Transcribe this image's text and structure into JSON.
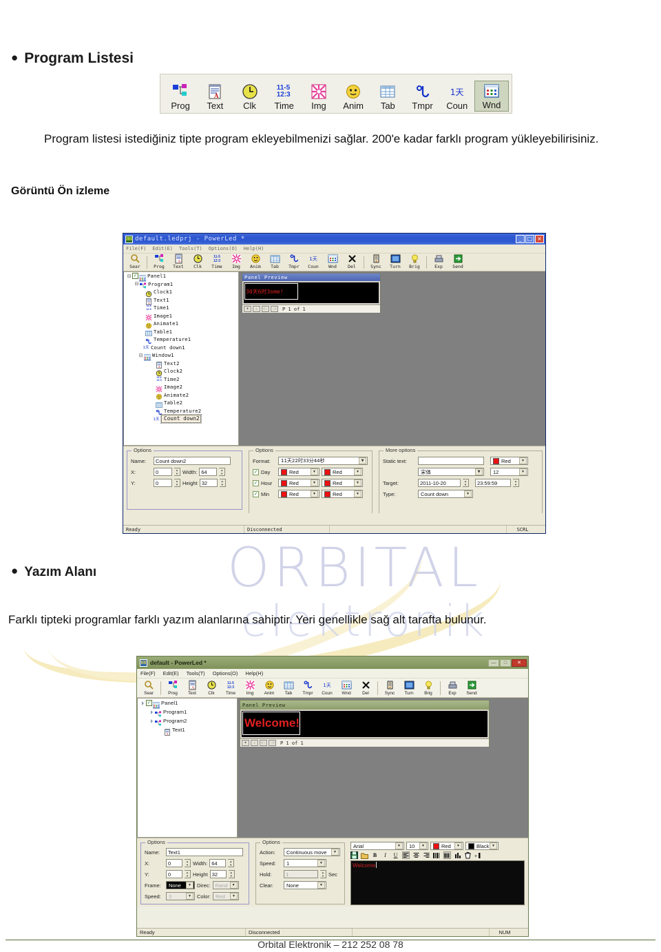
{
  "document": {
    "bullet1": "Program Listesi",
    "paragraph1": "Program listesi istediğiniz tipte program ekleyebilmenizi sağlar. 200'e kadar farklı program yükleyebilirisiniz.",
    "section1": "Görüntü Ön izleme",
    "bullet2": "Yazım Alanı",
    "paragraph2": "Farklı tipteki programlar farklı yazım alanlarına sahiptir. Yeri genellikle sağ alt tarafta bulunur.",
    "footer": "Orbital Elektronik – 212 252 08 78"
  },
  "watermark": {
    "line1": "ORBITAL",
    "line2": "elektronik"
  },
  "program_list_toolbar": {
    "items": [
      {
        "label": "Prog",
        "icon": "program-icon"
      },
      {
        "label": "Text",
        "icon": "text-icon"
      },
      {
        "label": "Clk",
        "icon": "clock-icon"
      },
      {
        "label": "Time",
        "icon": "time-icon"
      },
      {
        "label": "Img",
        "icon": "image-icon"
      },
      {
        "label": "Anim",
        "icon": "animate-icon"
      },
      {
        "label": "Tab",
        "icon": "table-icon"
      },
      {
        "label": "Tmpr",
        "icon": "temperature-icon"
      },
      {
        "label": "Coun",
        "icon": "countdown-icon"
      },
      {
        "label": "Wnd",
        "icon": "window-icon"
      }
    ],
    "selected": "Wnd"
  },
  "screenshot1": {
    "title": "default.ledprj - PowerLed *",
    "window_buttons": [
      "_",
      "□",
      "×"
    ],
    "menus": [
      "File(F)",
      "Edit(E)",
      "Tools(T)",
      "Options(O)",
      "Help(H)"
    ],
    "toolbar": [
      {
        "label": "Sear",
        "icon": "search-icon"
      },
      {
        "label": "Prog",
        "icon": "program-icon"
      },
      {
        "label": "Text",
        "icon": "text-icon"
      },
      {
        "label": "Clk",
        "icon": "clock-icon"
      },
      {
        "label": "Time",
        "icon": "time-icon"
      },
      {
        "label": "Img",
        "icon": "image-icon"
      },
      {
        "label": "Anim",
        "icon": "animate-icon"
      },
      {
        "label": "Tab",
        "icon": "table-icon"
      },
      {
        "label": "Tmpr",
        "icon": "temperature-icon"
      },
      {
        "label": "Coun",
        "icon": "countdown-icon"
      },
      {
        "label": "Wnd",
        "icon": "window-icon"
      },
      {
        "label": "Del",
        "icon": "delete-icon"
      },
      {
        "label": "Sync",
        "icon": "sync-icon"
      },
      {
        "label": "Turn",
        "icon": "turn-icon"
      },
      {
        "label": "Brig",
        "icon": "brightness-icon"
      },
      {
        "label": "Exp",
        "icon": "export-icon"
      },
      {
        "label": "Send",
        "icon": "send-icon"
      }
    ],
    "tree": [
      {
        "label": "Panel1",
        "depth": 0,
        "icon": "panel-icon",
        "checkbox": true,
        "expander": "minus"
      },
      {
        "label": "Program1",
        "depth": 1,
        "icon": "program-icon",
        "expander": "minus"
      },
      {
        "label": "Clock1",
        "depth": 2,
        "icon": "clock-icon"
      },
      {
        "label": "Text1",
        "depth": 2,
        "icon": "text-icon"
      },
      {
        "label": "Time1",
        "depth": 2,
        "icon": "time-icon"
      },
      {
        "label": "Image1",
        "depth": 2,
        "icon": "image-icon"
      },
      {
        "label": "Animate1",
        "depth": 2,
        "icon": "animate-icon"
      },
      {
        "label": "Table1",
        "depth": 2,
        "icon": "table-icon"
      },
      {
        "label": "Temperature1",
        "depth": 2,
        "icon": "temperature-icon"
      },
      {
        "label": "Count down1",
        "depth": 2,
        "icon": "countdown-icon"
      },
      {
        "label": "Window1",
        "depth": 2,
        "icon": "window-icon",
        "expander": "minus"
      },
      {
        "label": "Text2",
        "depth": 3,
        "icon": "text-icon"
      },
      {
        "label": "Clock2",
        "depth": 3,
        "icon": "clock-icon"
      },
      {
        "label": "Time2",
        "depth": 3,
        "icon": "time-icon"
      },
      {
        "label": "Image2",
        "depth": 3,
        "icon": "image-icon"
      },
      {
        "label": "Animate2",
        "depth": 3,
        "icon": "animate-icon"
      },
      {
        "label": "Table2",
        "depth": 3,
        "icon": "table-icon"
      },
      {
        "label": "Temperature2",
        "depth": 3,
        "icon": "temperature-icon"
      },
      {
        "label": "Count down2",
        "depth": 3,
        "icon": "countdown-icon",
        "selected": true
      }
    ],
    "preview": {
      "title": "Panel Preview",
      "led_text": "30天6时3ome!",
      "nav": [
        "+",
        "-",
        "<-",
        "->"
      ],
      "page_label": "P 1 of 1"
    },
    "options_left": {
      "title": "Options",
      "name_label": "Name:",
      "name_value": "Count down2",
      "x_label": "X:",
      "x_value": "0",
      "width_label": "Width:",
      "width_value": "64",
      "y_label": "Y:",
      "y_value": "0",
      "height_label": "Height",
      "height_value": "32"
    },
    "options_mid": {
      "title": "Options",
      "format_label": "Format:",
      "format_value": "11天22时33分44秒",
      "rows": [
        {
          "label": "Day",
          "checked": true,
          "color1": "Red",
          "color2": "Red"
        },
        {
          "label": "Hour",
          "checked": true,
          "color1": "Red",
          "color2": "Red"
        },
        {
          "label": "Min",
          "checked": true,
          "color1": "Red",
          "color2": "Red"
        }
      ],
      "color_hex": "#ee1111"
    },
    "options_right": {
      "title": "More options",
      "static_text_label": "Static text:",
      "static_text_value": "",
      "color_value": "Red",
      "font_value": "宋体",
      "size_value": "12",
      "target_label": "Target:",
      "target_date": "2011-10-20",
      "target_time": "23:59:59",
      "type_label": "Type:",
      "type_value": "Count down"
    },
    "status": {
      "left": "Ready",
      "middle": "Disconnected",
      "right": "SCRL"
    }
  },
  "screenshot2": {
    "title": "default - PowerLed *",
    "window_buttons": [
      "—",
      "□",
      "✕"
    ],
    "menus": [
      "File(F)",
      "Edit(E)",
      "Tools(T)",
      "Options(O)",
      "Help(H)"
    ],
    "toolbar": [
      {
        "label": "Sear",
        "icon": "search-icon"
      },
      {
        "label": "Prog",
        "icon": "program-icon"
      },
      {
        "label": "Text",
        "icon": "text-icon"
      },
      {
        "label": "Clk",
        "icon": "clock-icon"
      },
      {
        "label": "Time",
        "icon": "time-icon"
      },
      {
        "label": "Img",
        "icon": "image-icon"
      },
      {
        "label": "Anim",
        "icon": "animate-icon"
      },
      {
        "label": "Tab",
        "icon": "table-icon"
      },
      {
        "label": "Tmpr",
        "icon": "temperature-icon"
      },
      {
        "label": "Coun",
        "icon": "countdown-icon"
      },
      {
        "label": "Wnd",
        "icon": "window-icon"
      },
      {
        "label": "Del",
        "icon": "delete-icon"
      },
      {
        "label": "Sync",
        "icon": "sync-icon"
      },
      {
        "label": "Turn",
        "icon": "turn-icon"
      },
      {
        "label": "Brig",
        "icon": "brightness-icon"
      },
      {
        "label": "Exp",
        "icon": "export-icon"
      },
      {
        "label": "Send",
        "icon": "send-icon"
      }
    ],
    "tree": [
      {
        "label": "Panel1",
        "depth": 0,
        "icon": "panel-icon",
        "checkbox": true,
        "expander": "arrow"
      },
      {
        "label": "Program1",
        "depth": 1,
        "icon": "program-icon",
        "expander": "arrow"
      },
      {
        "label": "Program2",
        "depth": 1,
        "icon": "program-icon",
        "expander": "arrow"
      },
      {
        "label": "Text1",
        "depth": 2,
        "icon": "text-icon"
      }
    ],
    "preview": {
      "title": "Panel Preview",
      "led_text": "Welcome!",
      "nav": [
        "+",
        "-",
        "<-",
        "->"
      ],
      "page_label": "P 1 of 1"
    },
    "options_left": {
      "title": "Options",
      "name_label": "Name:",
      "name_value": "Text1",
      "x_label": "X:",
      "x_value": "0",
      "width_label": "Width:",
      "width_value": "64",
      "y_label": "Y:",
      "y_value": "0",
      "height_label": "Height",
      "height_value": "32",
      "frame_label": "Frame:",
      "frame_value": "None",
      "direc_label": "Direc:",
      "direc_value": "Rand",
      "speed_label": "Speed:",
      "speed_value": "3",
      "color_label": "Color:",
      "color_value": "Red"
    },
    "options_mid": {
      "title": "Options",
      "action_label": "Action:",
      "action_value": "Continuous move",
      "speed_label": "Speed:",
      "speed_value": "1",
      "hold_label": "Hold:",
      "hold_value": "1",
      "hold_unit": "Sec",
      "clear_label": "Clear:",
      "clear_value": "None"
    },
    "editor": {
      "font_value": "Arial",
      "size_value": "10",
      "fg_color": "Red",
      "bg_color": "Black",
      "fg_hex": "#ee1111",
      "bg_hex": "#000000",
      "buttons": [
        "save-icon",
        "open-icon",
        "bold-icon",
        "italic-icon",
        "underline-icon",
        "align-left-icon",
        "align-center-icon",
        "align-right-icon",
        "move-icon",
        "scroll-icon",
        "column-icon",
        "clear-icon",
        "insert-icon"
      ],
      "content": "Welcome"
    },
    "status": {
      "left": "Ready",
      "middle": "Disconnected",
      "right": "NUM"
    }
  }
}
